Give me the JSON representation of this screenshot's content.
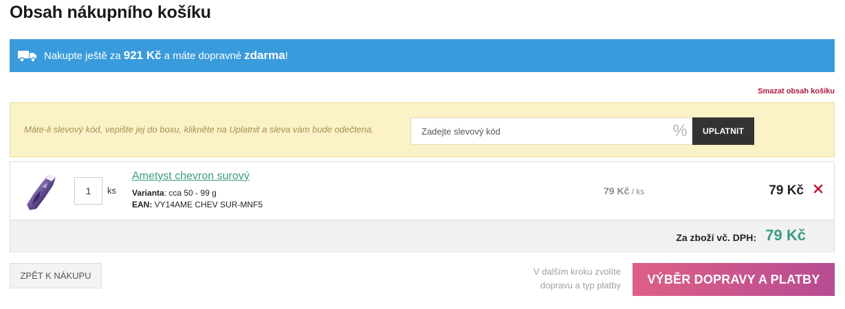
{
  "page_title": "Obsah nákupního košíku",
  "shipping_banner": {
    "text_before": "Nakupte ještě za",
    "amount": "921 Kč",
    "text_middle": "a máte dopravné",
    "free": "zdarma",
    "text_after": "!",
    "icon": "truck-icon",
    "color": "#3a9bdc"
  },
  "clear_cart_label": "Smazat obsah košíku",
  "coupon": {
    "info_text": "Máte-li slevový kód, vepište jej do boxu, klikněte na Uplatnit a sleva vám bude odečtena.",
    "placeholder": "Zadejte slevový kód",
    "percent_symbol": "%",
    "apply_label": "UPLATNIT"
  },
  "cart": {
    "items": [
      {
        "name": "Ametyst chevron surový",
        "quantity": "1",
        "unit": "ks",
        "variant_label": "Varianta",
        "variant_value": ": cca 50 - 99 g",
        "ean_label": "EAN:",
        "ean_value": " VY14AME CHEV SUR-MNF5",
        "unit_price": "79 Kč",
        "unit_price_suffix": " / ks",
        "total": "79 Kč",
        "remove_icon": "close-icon"
      }
    ],
    "total_label": "Za zboží vč. DPH:",
    "total_value": "79 Kč"
  },
  "back_label": "ZPĚT K NÁKUPU",
  "next_step_hint_line1": "V dalším kroku zvolíte",
  "next_step_hint_line2": "dopravu a typ platby",
  "continue_label": "VÝBĚR DOPRAVY A PLATBY",
  "colors": {
    "accent_green": "#3a9b82",
    "accent_red": "#b0163c",
    "coupon_bg": "#fbf2c7",
    "button_gradient_start": "#de5f86",
    "button_gradient_end": "#b74c93"
  }
}
